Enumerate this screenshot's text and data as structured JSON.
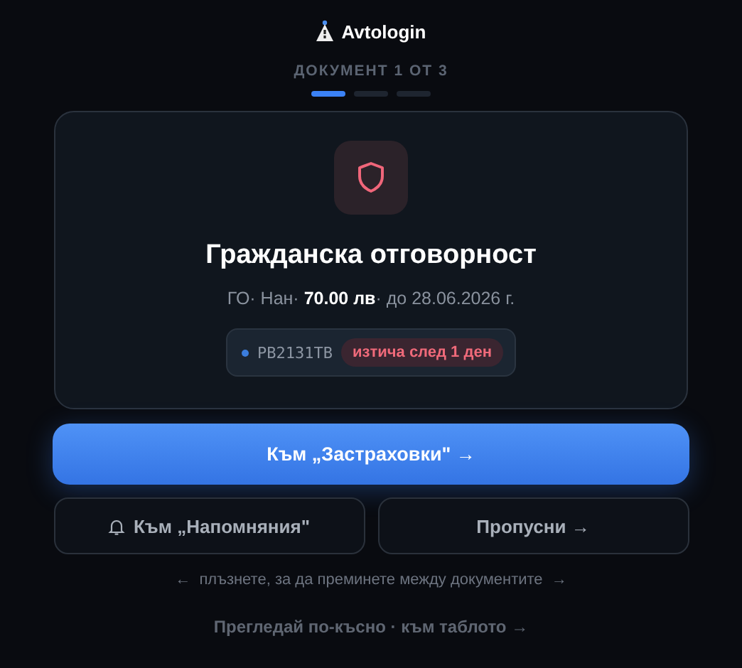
{
  "brand": {
    "name": "Avtologin"
  },
  "progress": {
    "label": "ДОКУМЕНТ 1 ОТ 3",
    "steps": [
      {
        "selected": true
      },
      {
        "selected": false
      },
      {
        "selected": false
      }
    ]
  },
  "card": {
    "title": "Гражданска отговорност",
    "subtitle": "ГО· Нан· **70.00 лв**· до 28.06.2026 г.",
    "plate": "PB2131TB",
    "badge": "изтича след 1 ден"
  },
  "primary_button": "Към „Застраховки\" →",
  "secondary_buttons": [
    {
      "kind": "bell",
      "label": "Към „Напомняния\""
    },
    {
      "kind": "plain",
      "label": "Пропусни →"
    }
  ],
  "hint": "←  плъзнете, за да преминете между документите  →",
  "footer_link": "Прегледай по-късно · към таблото →"
}
